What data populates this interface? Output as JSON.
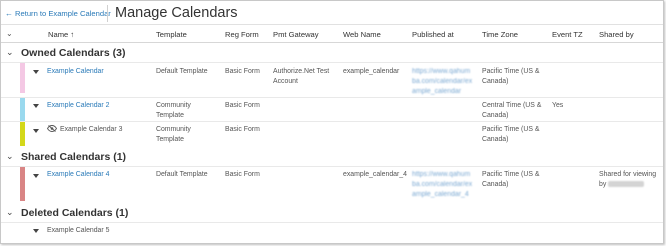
{
  "header": {
    "back_label": "Return to Example Calendar",
    "title": "Manage Calendars"
  },
  "columns": {
    "name": "Name",
    "sort_indicator": "↑",
    "template": "Template",
    "reg_form": "Reg Form",
    "pmt_gateway": "Pmt Gateway",
    "web_name": "Web Name",
    "published_at": "Published at",
    "time_zone": "Time Zone",
    "event_tz": "Event TZ",
    "shared_by": "Shared by"
  },
  "groups": {
    "owned": {
      "title": "Owned Calendars (3)"
    },
    "shared": {
      "title": "Shared Calendars (1)"
    },
    "deleted": {
      "title": "Deleted Calendars (1)"
    }
  },
  "rows": [
    {
      "name": "Example Calendar",
      "color": "#f4c8e4",
      "template_l1": "Default Template",
      "template_l2": "",
      "reg_form": "Basic Form",
      "pmt_gateway_l1": "Authorize.Net Test",
      "pmt_gateway_l2": "Account",
      "web_name": "example_calendar",
      "published_l1": "https://www.qahum",
      "published_l2": "ba.com/calendar/ex",
      "published_l3": "ample_calendar",
      "time_zone_l1": "Pacific Time (US &",
      "time_zone_l2": "Canada)",
      "event_tz": "",
      "shared_by_l1": "",
      "shared_by_l2": ""
    },
    {
      "name": "Example Calendar 2",
      "color": "#9ad9ee",
      "template_l1": "Community",
      "template_l2": "Template",
      "reg_form": "Basic Form",
      "pmt_gateway_l1": "",
      "pmt_gateway_l2": "",
      "web_name": "",
      "published_l1": "",
      "published_l2": "",
      "published_l3": "",
      "time_zone_l1": "Central Time (US &",
      "time_zone_l2": "Canada)",
      "event_tz": "Yes",
      "shared_by_l1": "",
      "shared_by_l2": ""
    },
    {
      "name": "Example Calendar 3",
      "color": "#d4d81a",
      "template_l1": "Community",
      "template_l2": "Template",
      "reg_form": "Basic Form",
      "pmt_gateway_l1": "",
      "pmt_gateway_l2": "",
      "web_name": "",
      "published_l1": "",
      "published_l2": "",
      "published_l3": "",
      "time_zone_l1": "Pacific Time (US &",
      "time_zone_l2": "Canada)",
      "event_tz": "",
      "shared_by_l1": "",
      "shared_by_l2": ""
    },
    {
      "name": "Example Calendar 4",
      "color": "#d98585",
      "template_l1": "Default Template",
      "template_l2": "",
      "reg_form": "Basic Form",
      "pmt_gateway_l1": "",
      "pmt_gateway_l2": "",
      "web_name": "example_calendar_4",
      "published_l1": "https://www.qahum",
      "published_l2": "ba.com/calendar/ex",
      "published_l3": "ample_calendar_4",
      "time_zone_l1": "Pacific Time (US &",
      "time_zone_l2": "Canada)",
      "event_tz": "",
      "shared_by_l1": "Shared for viewing",
      "shared_by_l2": "by"
    },
    {
      "name": "Example Calendar 5",
      "color": "",
      "template_l1": "",
      "template_l2": "",
      "reg_form": "",
      "pmt_gateway_l1": "",
      "pmt_gateway_l2": "",
      "web_name": "",
      "published_l1": "",
      "published_l2": "",
      "published_l3": "",
      "time_zone_l1": "",
      "time_zone_l2": "",
      "event_tz": "",
      "shared_by_l1": "",
      "shared_by_l2": ""
    }
  ],
  "icons": {
    "back": "arrow-left-icon",
    "collapse": "chevron-down-icon",
    "row_expand": "triangle-down-icon",
    "hidden": "eye-off-icon"
  },
  "colors": {
    "link": "#2a7ab8",
    "url": "#6d9fcc"
  }
}
